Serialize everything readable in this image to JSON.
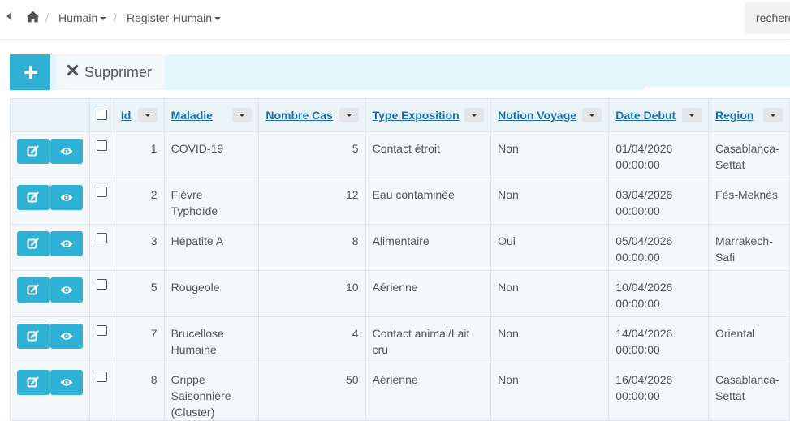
{
  "breadcrumb": {
    "items": [
      {
        "label": "Humain"
      },
      {
        "label": "Register-Humain"
      }
    ],
    "separator": "/"
  },
  "search": {
    "placeholder": "recherche"
  },
  "toolbar": {
    "add_icon": "plus-icon",
    "delete_label": "Supprimer",
    "delete_icon": "close-icon"
  },
  "colors": {
    "accent": "#31b0d5",
    "link": "#1b6fb0",
    "toolbar_bg": "#e3f6fc",
    "row_bg": "#f4f8fa"
  },
  "table": {
    "columns": [
      {
        "label": "Id"
      },
      {
        "label": "Maladie"
      },
      {
        "label": "Nombre Cas"
      },
      {
        "label": "Type Exposition"
      },
      {
        "label": "Notion Voyage"
      },
      {
        "label": "Date Debut"
      },
      {
        "label": "Region"
      }
    ],
    "row_actions": {
      "edit_icon": "edit-icon",
      "view_icon": "eye-icon"
    },
    "rows": [
      {
        "id": "1",
        "maladie": "COVID-19",
        "nombre_cas": "5",
        "type_exposition": "Contact étroit",
        "notion_voyage": "Non",
        "date_debut": "01/04/2026 00:00:00",
        "region": "Casablanca-Settat"
      },
      {
        "id": "2",
        "maladie": "Fièvre Typhoïde",
        "nombre_cas": "12",
        "type_exposition": "Eau contaminée",
        "notion_voyage": "Non",
        "date_debut": "03/04/2026 00:00:00",
        "region": "Fès-Meknès"
      },
      {
        "id": "3",
        "maladie": "Hépatite A",
        "nombre_cas": "8",
        "type_exposition": "Alimentaire",
        "notion_voyage": "Oui",
        "date_debut": "05/04/2026 00:00:00",
        "region": "Marrakech-Safi"
      },
      {
        "id": "5",
        "maladie": "Rougeole",
        "nombre_cas": "10",
        "type_exposition": "Aérienne",
        "notion_voyage": "Non",
        "date_debut": "10/04/2026 00:00:00",
        "region": ""
      },
      {
        "id": "7",
        "maladie": "Brucellose Humaine",
        "nombre_cas": "4",
        "type_exposition": "Contact animal/Lait cru",
        "notion_voyage": "Non",
        "date_debut": "14/04/2026 00:00:00",
        "region": "Oriental"
      },
      {
        "id": "8",
        "maladie": "Grippe Saisonnière (Cluster)",
        "nombre_cas": "50",
        "type_exposition": "Aérienne",
        "notion_voyage": "Non",
        "date_debut": "16/04/2026 00:00:00",
        "region": "Casablanca-Settat"
      }
    ]
  }
}
